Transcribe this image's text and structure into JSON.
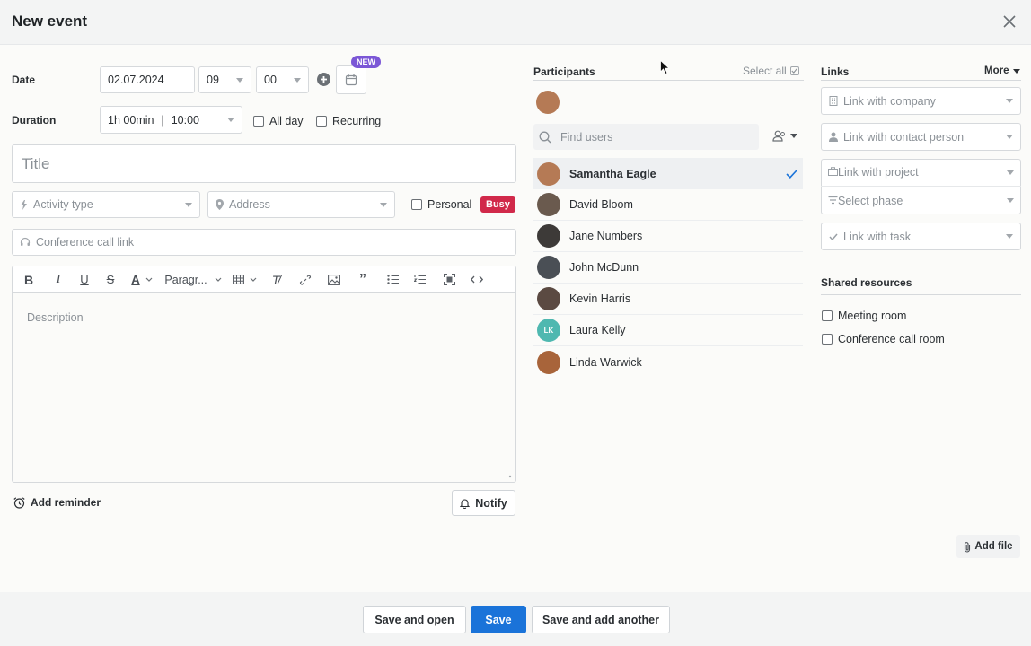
{
  "header": {
    "title": "New event"
  },
  "date": {
    "label": "Date",
    "value": "02.07.2024",
    "hour": "09",
    "minute": "00",
    "new_badge": "NEW"
  },
  "duration": {
    "label": "Duration",
    "length": "1h 00min",
    "end_time": "10:00",
    "all_day_label": "All day",
    "recurring_label": "Recurring"
  },
  "title_field": {
    "placeholder": "Title"
  },
  "activity": {
    "placeholder": "Activity type"
  },
  "address": {
    "placeholder": "Address"
  },
  "personal": {
    "label": "Personal",
    "busy_badge": "Busy"
  },
  "conference": {
    "placeholder": "Conference call link"
  },
  "editor": {
    "paragraph_label": "Paragr...",
    "description_placeholder": "Description"
  },
  "reminder": {
    "label": "Add reminder"
  },
  "notify": {
    "label": "Notify"
  },
  "participants": {
    "heading": "Participants",
    "select_all": "Select all",
    "find_placeholder": "Find users",
    "users": [
      {
        "name": "Samantha Eagle",
        "selected": true,
        "avatar_color": "#b57a55",
        "initials": ""
      },
      {
        "name": "David Bloom",
        "selected": false,
        "avatar_color": "#6a5a4e",
        "initials": ""
      },
      {
        "name": "Jane Numbers",
        "selected": false,
        "avatar_color": "#3d3a38",
        "initials": ""
      },
      {
        "name": "John McDunn",
        "selected": false,
        "avatar_color": "#4a4f55",
        "initials": ""
      },
      {
        "name": "Kevin Harris",
        "selected": false,
        "avatar_color": "#5b4a42",
        "initials": ""
      },
      {
        "name": "Laura Kelly",
        "selected": false,
        "avatar_color": "#4fb8b0",
        "initials": "LK"
      },
      {
        "name": "Linda Warwick",
        "selected": false,
        "avatar_color": "#a8643a",
        "initials": ""
      }
    ]
  },
  "links": {
    "heading": "Links",
    "more": "More",
    "company": "Link with company",
    "contact": "Link with contact person",
    "project": "Link with project",
    "phase": "Select phase",
    "task": "Link with task"
  },
  "shared": {
    "heading": "Shared resources",
    "meeting_room": "Meeting room",
    "conference_room": "Conference call room"
  },
  "add_file": {
    "label": "Add file"
  },
  "footer": {
    "save_and_open": "Save and open",
    "save": "Save",
    "save_and_add_another": "Save and add another"
  },
  "colors": {
    "accent": "#1a73d9",
    "busy": "#d1294a",
    "new_badge": "#7b57d6"
  }
}
